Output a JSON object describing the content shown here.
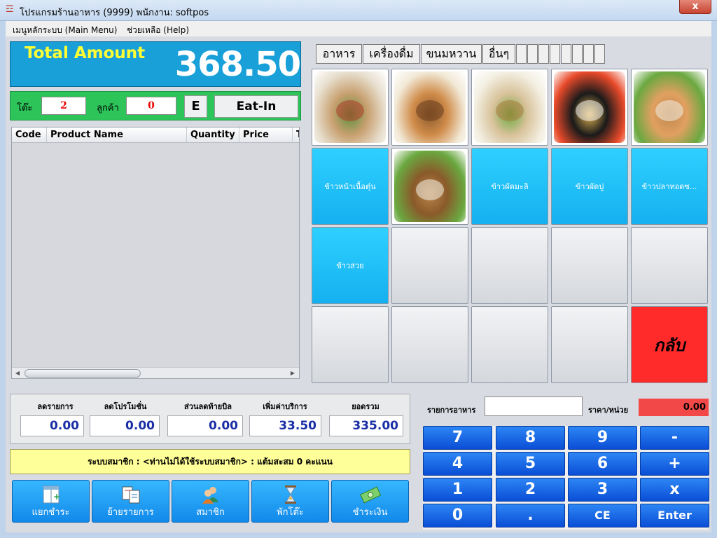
{
  "window": {
    "title": "โปรแกรมร้านอาหาร (9999) พนักงาน: softpos",
    "close_symbol": "x"
  },
  "menu": [
    {
      "label": "เมนูหลักระบบ (Main Menu)"
    },
    {
      "label": "ช่วยเหลือ (Help)"
    }
  ],
  "total": {
    "label": "Total Amount",
    "value": "368.50"
  },
  "table_info": {
    "table_label": "โต๊ะ",
    "table_value": "2",
    "customer_label": "ลูกค้า",
    "customer_value": "0",
    "mode_code": "E",
    "mode_label": "Eat-In"
  },
  "grid": {
    "columns": [
      "Code",
      "Product Name",
      "Quantity",
      "Price",
      "T"
    ],
    "rows": []
  },
  "categories": [
    {
      "label": "อาหาร"
    },
    {
      "label": "เครื่องดื่ม"
    },
    {
      "label": "ขนมหวาน"
    },
    {
      "label": "อื่นๆ"
    }
  ],
  "products": [
    {
      "type": "photo",
      "name": "food-photo-1"
    },
    {
      "type": "photo",
      "name": "food-photo-2"
    },
    {
      "type": "photo",
      "name": "food-photo-3"
    },
    {
      "type": "photo",
      "name": "food-photo-4"
    },
    {
      "type": "photo",
      "name": "food-photo-5"
    },
    {
      "type": "label",
      "label": "ข้าวหน้าเนื้อตุ๋น"
    },
    {
      "type": "photo",
      "name": "food-photo-6"
    },
    {
      "type": "label",
      "label": "ข้าวผัดมะลิ"
    },
    {
      "type": "label",
      "label": "ข้าวผัดปู"
    },
    {
      "type": "label",
      "label": "ข้าวปลาทอดซ..."
    },
    {
      "type": "label",
      "label": "ข้าวสวย"
    },
    {
      "type": "empty"
    },
    {
      "type": "empty"
    },
    {
      "type": "empty"
    },
    {
      "type": "empty"
    },
    {
      "type": "empty"
    },
    {
      "type": "empty"
    },
    {
      "type": "empty"
    },
    {
      "type": "empty"
    },
    {
      "type": "back",
      "label": "กลับ"
    }
  ],
  "discounts": {
    "item_discount": {
      "label": "ลดรายการ",
      "value": "0.00"
    },
    "promo_discount": {
      "label": "ลดโปรโมชั่น",
      "value": "0.00"
    },
    "bill_discount": {
      "label": "ส่วนลดท้ายบิล",
      "value": "0.00"
    },
    "service_charge": {
      "label": "เพิ่มค่าบริการ",
      "value": "33.50"
    },
    "subtotal": {
      "label": "ยอดรวม",
      "value": "335.00"
    }
  },
  "member": {
    "text": "ระบบสมาชิก : <ท่านไม่ได้ใช้ระบบสมาชิก> : แต้มสะสม 0 คะแนน"
  },
  "actions": [
    {
      "label": "แยกชำระ",
      "icon": "split-bill-icon"
    },
    {
      "label": "ย้ายรายการ",
      "icon": "move-items-icon"
    },
    {
      "label": "สมาชิก",
      "icon": "members-icon"
    },
    {
      "label": "พักโต๊ะ",
      "icon": "hourglass-icon"
    },
    {
      "label": "ชำระเงิน",
      "icon": "cash-icon"
    }
  ],
  "entry": {
    "item_label": "รายการอาหาร",
    "item_value": "",
    "price_label": "ราคา/หน่วย",
    "price_value": "0.00"
  },
  "keypad": [
    "7",
    "8",
    "9",
    "-",
    "4",
    "5",
    "6",
    "+",
    "1",
    "2",
    "3",
    "x",
    "0",
    ".",
    "CE",
    "Enter"
  ],
  "colors": {
    "accent_blue": "#1aa0d9",
    "total_yellow": "#ffff33",
    "table_green": "#2dc45a",
    "product_cyan": "#14b0f0",
    "back_red": "#ff2a2a",
    "keypad_blue": "#0a4ed6"
  }
}
